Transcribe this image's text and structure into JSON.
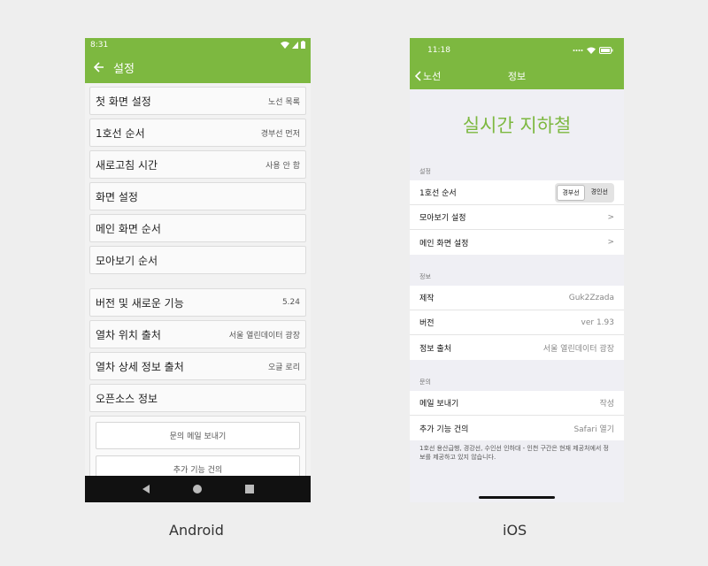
{
  "android": {
    "status": {
      "time": "8:31"
    },
    "appbar": {
      "title": "설정"
    },
    "items": [
      {
        "label": "첫 화면 설정",
        "value": "노선 목록"
      },
      {
        "label": "1호선 순서",
        "value": "경부선 먼저"
      },
      {
        "label": "새로고침 시간",
        "value": "사용 안 함"
      },
      {
        "label": "화면 설정",
        "value": ""
      },
      {
        "label": "메인 화면 순서",
        "value": ""
      },
      {
        "label": "모아보기 순서",
        "value": ""
      }
    ],
    "items2": [
      {
        "label": "버전 및 새로운 기능",
        "value": "5.24"
      },
      {
        "label": "열차 위치 출처",
        "value": "서울 열린데이터 광장"
      },
      {
        "label": "열차 상세 정보 출처",
        "value": "오글 로리"
      },
      {
        "label": "오픈소스 정보",
        "value": ""
      }
    ],
    "buttons": [
      "문의 메일 보내기",
      "추가 기능 건의"
    ],
    "caption": "Android"
  },
  "ios": {
    "status": {
      "time": "11:18"
    },
    "nav": {
      "back": "노선",
      "title": "정보"
    },
    "hero": "실시간 지하철",
    "sections": {
      "settings": {
        "header": "설정",
        "line1": {
          "label": "1호선 순서",
          "options": [
            "경부선",
            "경인선"
          ],
          "selected": "경부선"
        },
        "rows": [
          {
            "label": "모아보기 설정",
            "value": ">"
          },
          {
            "label": "메인 화면 설정",
            "value": ">"
          }
        ]
      },
      "info": {
        "header": "정보",
        "rows": [
          {
            "label": "제작",
            "value": "Guk2Zzada"
          },
          {
            "label": "버전",
            "value": "ver 1.93"
          },
          {
            "label": "정보 출처",
            "value": "서울 열린데이터 광장"
          }
        ]
      },
      "contact": {
        "header": "문의",
        "rows": [
          {
            "label": "메일 보내기",
            "value": "작성"
          },
          {
            "label": "추가 기능 건의",
            "value": "Safari 열기"
          }
        ]
      }
    },
    "footnote": "1호선 용산급행, 경강선, 수인선 인하대 - 인천 구간은 현재 제공처에서 정보를 제공하고 있지 않습니다.",
    "caption": "iOS"
  },
  "colors": {
    "accent": "#7db840"
  }
}
